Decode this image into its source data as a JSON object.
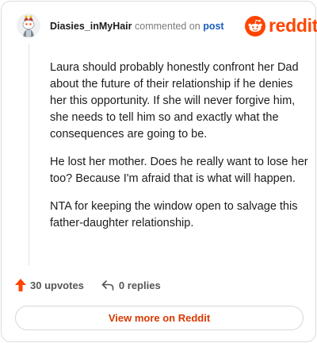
{
  "comment": {
    "username": "Diasies_inMyHair",
    "action_text": "commented on",
    "post_link": "post",
    "paragraphs": [
      "Laura should probably honestly confront her Dad about the future of their relationship if he denies her this opportunity. If she will never forgive him, she needs to tell him so and exactly what the consequences are going to be.",
      "He lost her mother. Does he really want to lose her too? Because I'm afraid that is what will happen.",
      "NTA for keeping the window open to salvage this father-daughter relationship."
    ]
  },
  "brand": {
    "name": "reddit",
    "color": "#ff4500",
    "icon": "reddit-logo-icon"
  },
  "stats": {
    "upvotes_label": "30 upvotes",
    "replies_label": "0 replies",
    "upvote_icon": "upvote-arrow-icon",
    "reply_icon": "reply-arrow-icon"
  },
  "cta": {
    "label": "View more on Reddit",
    "color": "#d93a00"
  }
}
